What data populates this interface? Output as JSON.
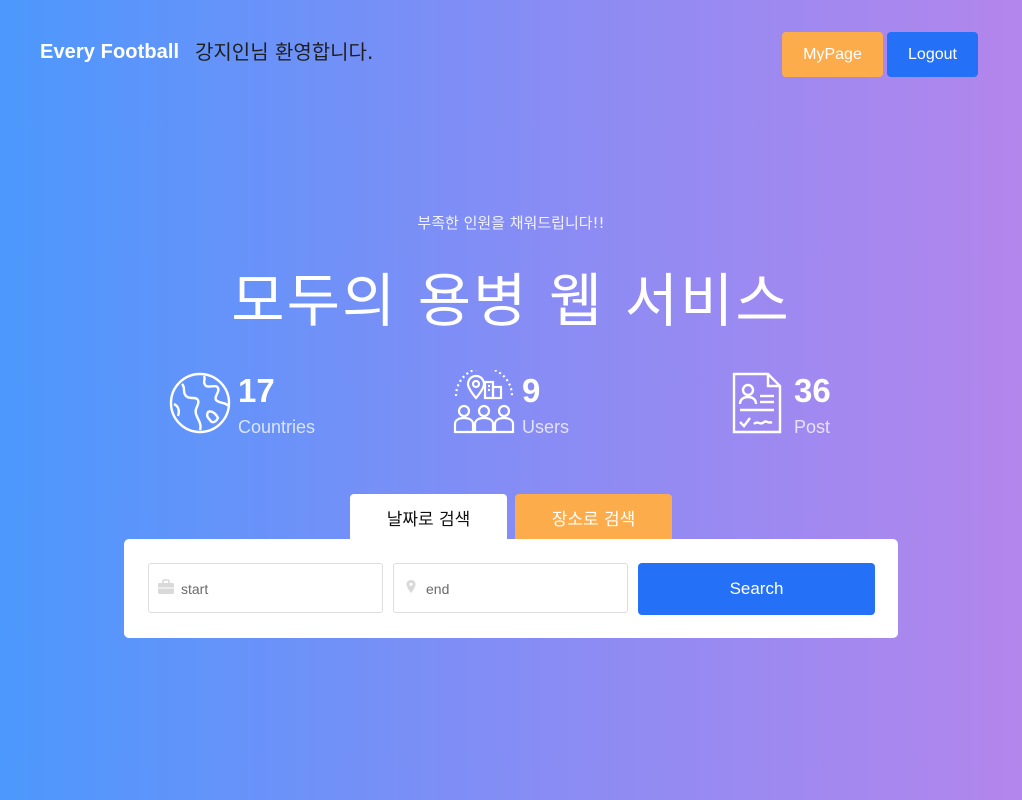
{
  "header": {
    "brand": "Every Football",
    "welcome": "강지인님 환영합니다.",
    "mypage_label": "MyPage",
    "logout_label": "Logout"
  },
  "hero": {
    "subtitle": "부족한 인원을 채워드립니다!!",
    "title": "모두의 용병 웹 서비스"
  },
  "stats": [
    {
      "icon": "globe-icon",
      "value": "17",
      "label": "Countries"
    },
    {
      "icon": "users-location-icon",
      "value": "9",
      "label": "Users"
    },
    {
      "icon": "document-icon",
      "value": "36",
      "label": "Post"
    }
  ],
  "tabs": [
    {
      "label": "날짜로 검색",
      "active": true
    },
    {
      "label": "장소로 검색",
      "active": false
    }
  ],
  "search": {
    "start_placeholder": "start",
    "end_placeholder": "end",
    "button_label": "Search"
  },
  "colors": {
    "gradient_start": "#4c98fd",
    "gradient_end": "#b386ec",
    "accent_orange": "#fdac4c",
    "accent_blue": "#2470f6"
  }
}
